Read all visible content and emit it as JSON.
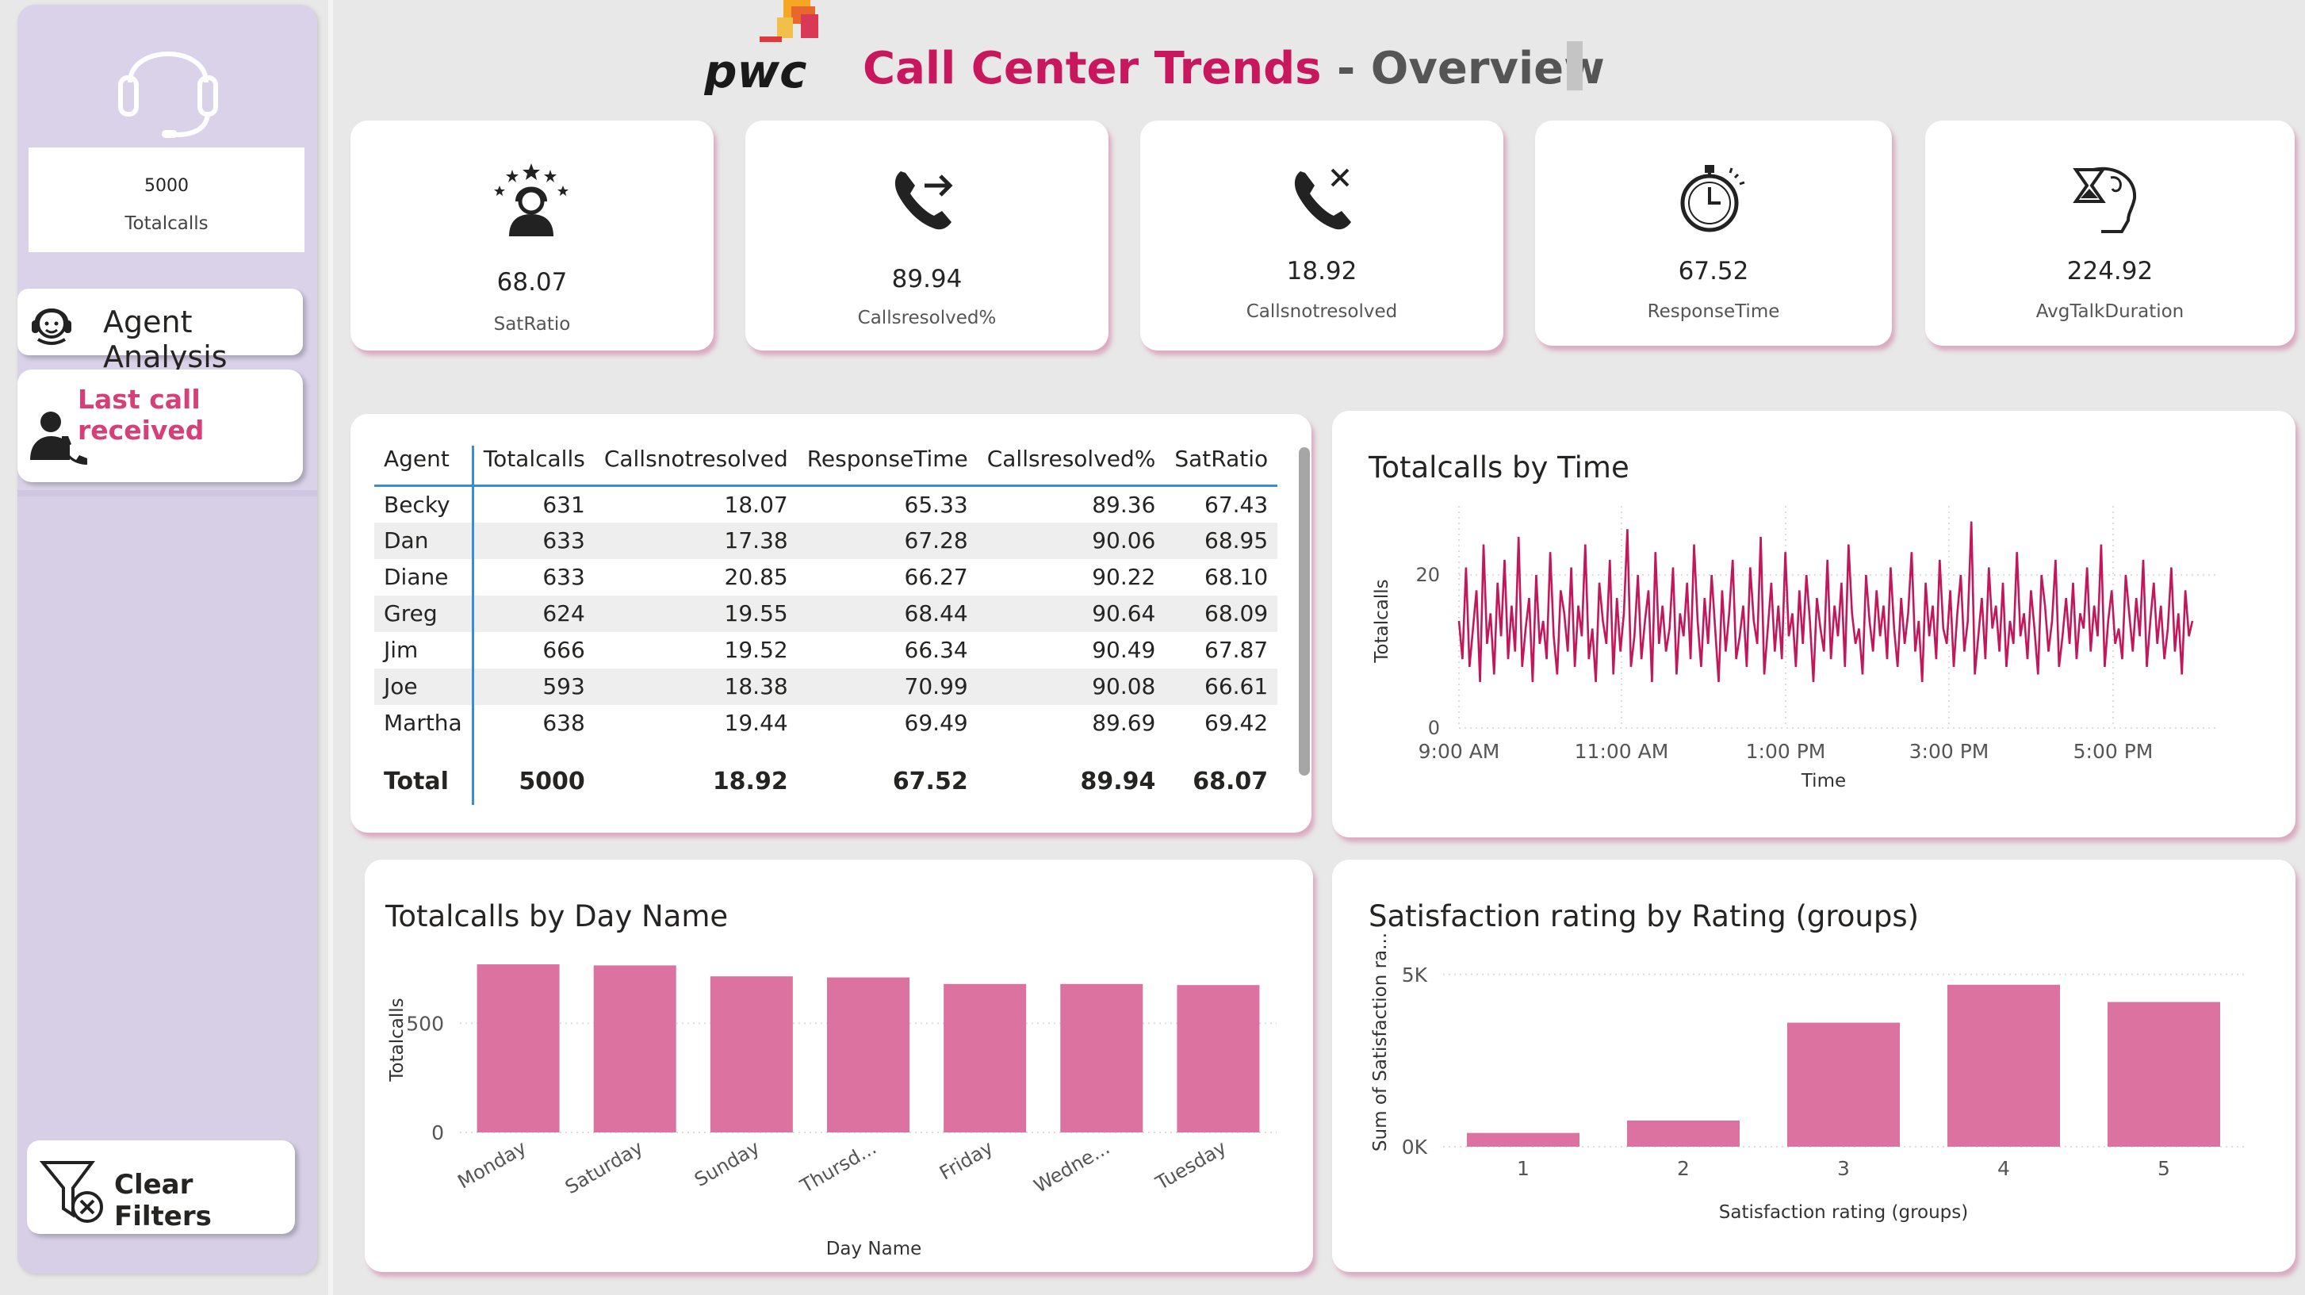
{
  "header": {
    "logo_text": "pwc",
    "title_main": "Call Center Trends",
    "title_sep": " - ",
    "title_sub": "Overview"
  },
  "sidebar": {
    "total_value": "5000",
    "total_label": "Totalcalls",
    "agent_analysis_label": "Agent Analysis",
    "last_call_label": "Last call received",
    "clear_filters_label": "Clear Filters"
  },
  "kpis": [
    {
      "value": "68.07",
      "label": "SatRatio",
      "icon": "star-agent-icon"
    },
    {
      "value": "89.94",
      "label": "Callsresolved%",
      "icon": "call-forward-icon"
    },
    {
      "value": "18.92",
      "label": "Callsnotresolved",
      "icon": "call-declined-icon"
    },
    {
      "value": "67.52",
      "label": "ResponseTime",
      "icon": "stopwatch-icon"
    },
    {
      "value": "224.92",
      "label": "AvgTalkDuration",
      "icon": "hourglass-head-icon"
    }
  ],
  "table": {
    "columns": [
      "Agent",
      "Totalcalls",
      "Callsnotresolved",
      "ResponseTime",
      "Callsresolved%",
      "SatRatio"
    ],
    "rows": [
      [
        "Becky",
        "631",
        "18.07",
        "65.33",
        "89.36",
        "67.43"
      ],
      [
        "Dan",
        "633",
        "17.38",
        "67.28",
        "90.06",
        "68.95"
      ],
      [
        "Diane",
        "633",
        "20.85",
        "66.27",
        "90.22",
        "68.10"
      ],
      [
        "Greg",
        "624",
        "19.55",
        "68.44",
        "90.64",
        "68.09"
      ],
      [
        "Jim",
        "666",
        "19.52",
        "66.34",
        "90.49",
        "67.87"
      ],
      [
        "Joe",
        "593",
        "18.38",
        "70.99",
        "90.08",
        "66.61"
      ],
      [
        "Martha",
        "638",
        "19.44",
        "69.49",
        "89.69",
        "69.42"
      ]
    ],
    "total": [
      "Total",
      "5000",
      "18.92",
      "67.52",
      "89.94",
      "68.07"
    ]
  },
  "chart_data": [
    {
      "type": "line",
      "title": "Totalcalls by Time",
      "xlabel": "Time",
      "ylabel": "Totalcalls",
      "x_ticks": [
        "9:00 AM",
        "11:00 AM",
        "1:00 PM",
        "3:00 PM",
        "5:00 PM"
      ],
      "x_range": [
        "9:00 AM",
        "5:59 PM"
      ],
      "y_ticks": [
        "0",
        "20"
      ],
      "ylim": [
        0,
        28
      ],
      "color": "#c2185b",
      "series": [
        {
          "values": [
            14,
            9,
            21,
            8,
            13,
            18,
            6,
            24,
            11,
            15,
            7,
            19,
            12,
            22,
            9,
            16,
            10,
            25,
            8,
            13,
            17,
            6,
            20,
            11,
            14,
            9,
            23,
            12,
            7,
            18,
            15,
            10,
            21,
            8,
            16,
            12,
            24,
            9,
            13,
            6,
            19,
            14,
            11,
            22,
            7,
            17,
            10,
            15,
            26,
            8,
            12,
            20,
            9,
            14,
            18,
            6,
            23,
            11,
            16,
            10,
            13,
            21,
            7,
            15,
            12,
            19,
            9,
            24,
            14,
            8,
            17,
            11,
            20,
            13,
            6,
            18,
            10,
            15,
            22,
            9,
            12,
            16,
            8,
            21,
            14,
            11,
            25,
            7,
            13,
            19,
            10,
            16,
            9,
            23,
            12,
            15,
            8,
            18,
            11,
            20,
            14,
            6,
            17,
            13,
            10,
            22,
            9,
            16,
            12,
            19,
            8,
            24,
            15,
            11,
            13,
            7,
            20,
            14,
            10,
            18,
            12,
            16,
            9,
            21,
            13,
            8,
            17,
            11,
            15,
            23,
            10,
            14,
            6,
            19,
            12,
            16,
            9,
            22,
            13,
            11,
            18,
            8,
            15,
            20,
            10,
            14,
            27,
            7,
            12,
            17,
            9,
            21,
            13,
            16,
            10,
            19,
            8,
            14,
            11,
            23,
            12,
            15,
            9,
            18,
            13,
            7,
            20,
            16,
            10,
            14,
            22,
            8,
            12,
            17,
            11,
            19,
            9,
            15,
            13,
            21,
            10,
            16,
            12,
            24,
            8,
            14,
            18,
            11,
            13,
            9,
            20,
            15,
            10,
            17,
            12,
            22,
            8,
            14,
            19,
            11,
            16,
            9,
            13,
            21,
            10,
            15,
            7,
            18,
            12,
            14
          ]
        }
      ]
    },
    {
      "type": "bar",
      "title": "Totalcalls by Day Name",
      "xlabel": "Day Name",
      "ylabel": "Totalcalls",
      "categories": [
        "Monday",
        "Saturday",
        "Sunday",
        "Thursd...",
        "Friday",
        "Wedne...",
        "Tuesday"
      ],
      "values": [
        770,
        765,
        715,
        710,
        680,
        680,
        675
      ],
      "y_ticks": [
        "0",
        "500"
      ],
      "ylim": [
        0,
        850
      ],
      "color": "#db729f"
    },
    {
      "type": "bar",
      "title": "Satisfaction rating by Rating (groups)",
      "xlabel": "Satisfaction rating (groups)",
      "ylabel": "Sum of Satisfaction ra...",
      "categories": [
        "1",
        "2",
        "3",
        "4",
        "5"
      ],
      "values": [
        400,
        760,
        3600,
        4700,
        4200
      ],
      "y_ticks": [
        "0K",
        "5K"
      ],
      "ylim": [
        0,
        5800
      ],
      "color": "#db729f"
    }
  ]
}
